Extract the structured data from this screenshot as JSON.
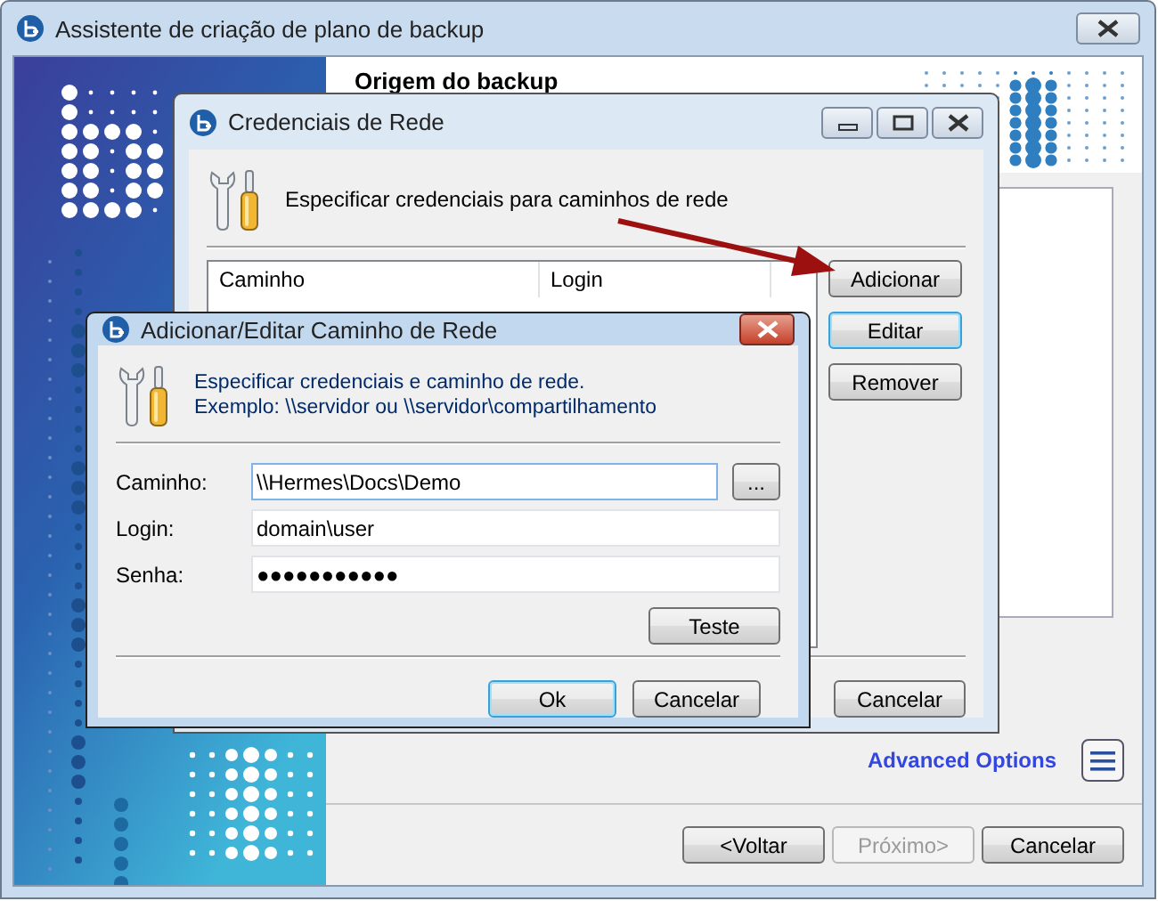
{
  "main_window": {
    "title": "Assistente de criação de plano de backup",
    "header_title": "Origem do backup",
    "advanced_options": "Advanced Options",
    "buttons": [
      {
        "label": "<Voltar",
        "disabled": false
      },
      {
        "label": "Próximo>",
        "disabled": true
      },
      {
        "label": "Cancelar",
        "disabled": false
      }
    ]
  },
  "credentials_window": {
    "title": "Credenciais de Rede",
    "description": "Especificar credenciais para caminhos de rede",
    "table": {
      "columns": [
        "Caminho",
        "Login"
      ]
    },
    "side_buttons": [
      {
        "label": "Adicionar",
        "focused": false
      },
      {
        "label": "Editar",
        "focused": true
      },
      {
        "label": "Remover",
        "focused": false
      }
    ],
    "bottom_buttons": [
      "Cancelar"
    ]
  },
  "edit_dialog": {
    "title": "Adicionar/Editar Caminho de Rede",
    "description_lines": [
      "Especificar credenciais e caminho de rede.",
      "Exemplo: \\\\servidor ou \\\\servidor\\compartilhamento"
    ],
    "fields": [
      {
        "label": "Caminho:",
        "value": "\\\\Hermes\\Docs\\Demo",
        "browse": "...",
        "focused": true
      },
      {
        "label": "Login:",
        "value": "domain\\user",
        "focused": false
      },
      {
        "label": "Senha:",
        "value": "●●●●●●●●●●●",
        "focused": false
      }
    ],
    "test_button": "Teste",
    "buttons": [
      {
        "label": "Ok",
        "focused": true
      },
      {
        "label": "Cancelar",
        "focused": false
      }
    ]
  }
}
